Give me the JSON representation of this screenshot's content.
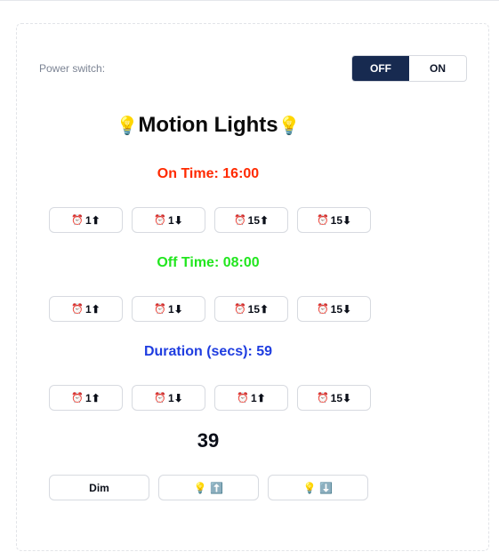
{
  "power": {
    "label": "Power switch:",
    "off_label": "OFF",
    "on_label": "ON",
    "selected": "OFF"
  },
  "title": {
    "text": "Motion Lights",
    "bulb": "💡"
  },
  "on_time": {
    "label": "On Time: 16:00",
    "color": "#ff2a00",
    "buttons": [
      {
        "icon": "⏰",
        "text": "1",
        "arrow": "⬆"
      },
      {
        "icon": "⏰",
        "text": "1",
        "arrow": "⬇"
      },
      {
        "icon": "⏰",
        "text": "15",
        "arrow": "⬆"
      },
      {
        "icon": "⏰",
        "text": "15",
        "arrow": "⬇"
      }
    ]
  },
  "off_time": {
    "label": "Off Time: 08:00",
    "color": "#22e61f",
    "buttons": [
      {
        "icon": "⏰",
        "text": "1",
        "arrow": "⬆"
      },
      {
        "icon": "⏰",
        "text": "1",
        "arrow": "⬇"
      },
      {
        "icon": "⏰",
        "text": "15",
        "arrow": "⬆"
      },
      {
        "icon": "⏰",
        "text": "15",
        "arrow": "⬇"
      }
    ]
  },
  "duration": {
    "label": "Duration (secs): 59",
    "color": "#1f3de0",
    "buttons": [
      {
        "icon": "⏰",
        "text": "1",
        "arrow": "⬆"
      },
      {
        "icon": "⏰",
        "text": "1",
        "arrow": "⬇"
      },
      {
        "icon": "⏰",
        "text": "1",
        "arrow": "⬆"
      },
      {
        "icon": "⏰",
        "text": "15",
        "arrow": "⬇"
      }
    ]
  },
  "brightness": {
    "value": "39",
    "dim_label": "Dim",
    "up_label": "💡 ⬆️",
    "down_label": "💡 ⬇️"
  }
}
